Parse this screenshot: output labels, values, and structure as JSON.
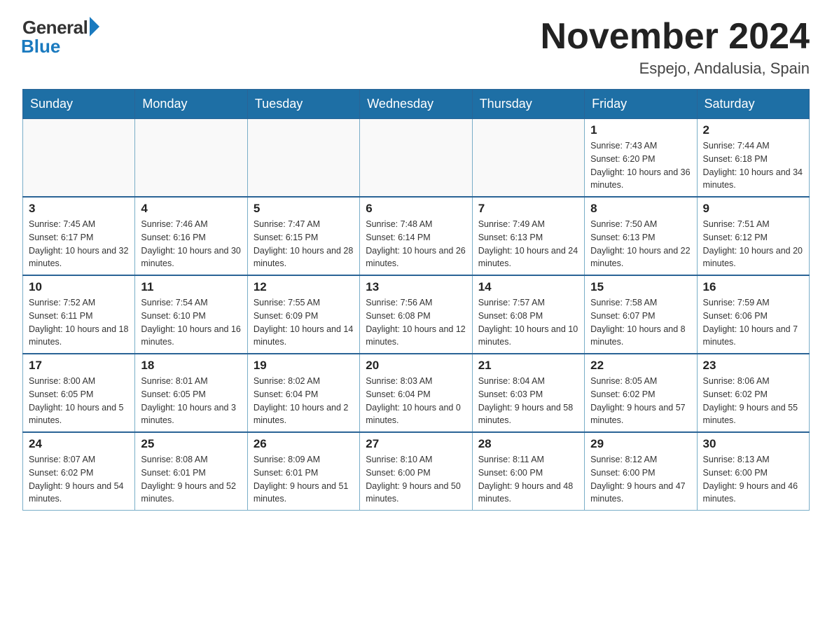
{
  "logo": {
    "general": "General",
    "blue": "Blue"
  },
  "title": "November 2024",
  "location": "Espejo, Andalusia, Spain",
  "weekdays": [
    "Sunday",
    "Monday",
    "Tuesday",
    "Wednesday",
    "Thursday",
    "Friday",
    "Saturday"
  ],
  "weeks": [
    [
      {
        "day": "",
        "info": ""
      },
      {
        "day": "",
        "info": ""
      },
      {
        "day": "",
        "info": ""
      },
      {
        "day": "",
        "info": ""
      },
      {
        "day": "",
        "info": ""
      },
      {
        "day": "1",
        "info": "Sunrise: 7:43 AM\nSunset: 6:20 PM\nDaylight: 10 hours and 36 minutes."
      },
      {
        "day": "2",
        "info": "Sunrise: 7:44 AM\nSunset: 6:18 PM\nDaylight: 10 hours and 34 minutes."
      }
    ],
    [
      {
        "day": "3",
        "info": "Sunrise: 7:45 AM\nSunset: 6:17 PM\nDaylight: 10 hours and 32 minutes."
      },
      {
        "day": "4",
        "info": "Sunrise: 7:46 AM\nSunset: 6:16 PM\nDaylight: 10 hours and 30 minutes."
      },
      {
        "day": "5",
        "info": "Sunrise: 7:47 AM\nSunset: 6:15 PM\nDaylight: 10 hours and 28 minutes."
      },
      {
        "day": "6",
        "info": "Sunrise: 7:48 AM\nSunset: 6:14 PM\nDaylight: 10 hours and 26 minutes."
      },
      {
        "day": "7",
        "info": "Sunrise: 7:49 AM\nSunset: 6:13 PM\nDaylight: 10 hours and 24 minutes."
      },
      {
        "day": "8",
        "info": "Sunrise: 7:50 AM\nSunset: 6:13 PM\nDaylight: 10 hours and 22 minutes."
      },
      {
        "day": "9",
        "info": "Sunrise: 7:51 AM\nSunset: 6:12 PM\nDaylight: 10 hours and 20 minutes."
      }
    ],
    [
      {
        "day": "10",
        "info": "Sunrise: 7:52 AM\nSunset: 6:11 PM\nDaylight: 10 hours and 18 minutes."
      },
      {
        "day": "11",
        "info": "Sunrise: 7:54 AM\nSunset: 6:10 PM\nDaylight: 10 hours and 16 minutes."
      },
      {
        "day": "12",
        "info": "Sunrise: 7:55 AM\nSunset: 6:09 PM\nDaylight: 10 hours and 14 minutes."
      },
      {
        "day": "13",
        "info": "Sunrise: 7:56 AM\nSunset: 6:08 PM\nDaylight: 10 hours and 12 minutes."
      },
      {
        "day": "14",
        "info": "Sunrise: 7:57 AM\nSunset: 6:08 PM\nDaylight: 10 hours and 10 minutes."
      },
      {
        "day": "15",
        "info": "Sunrise: 7:58 AM\nSunset: 6:07 PM\nDaylight: 10 hours and 8 minutes."
      },
      {
        "day": "16",
        "info": "Sunrise: 7:59 AM\nSunset: 6:06 PM\nDaylight: 10 hours and 7 minutes."
      }
    ],
    [
      {
        "day": "17",
        "info": "Sunrise: 8:00 AM\nSunset: 6:05 PM\nDaylight: 10 hours and 5 minutes."
      },
      {
        "day": "18",
        "info": "Sunrise: 8:01 AM\nSunset: 6:05 PM\nDaylight: 10 hours and 3 minutes."
      },
      {
        "day": "19",
        "info": "Sunrise: 8:02 AM\nSunset: 6:04 PM\nDaylight: 10 hours and 2 minutes."
      },
      {
        "day": "20",
        "info": "Sunrise: 8:03 AM\nSunset: 6:04 PM\nDaylight: 10 hours and 0 minutes."
      },
      {
        "day": "21",
        "info": "Sunrise: 8:04 AM\nSunset: 6:03 PM\nDaylight: 9 hours and 58 minutes."
      },
      {
        "day": "22",
        "info": "Sunrise: 8:05 AM\nSunset: 6:02 PM\nDaylight: 9 hours and 57 minutes."
      },
      {
        "day": "23",
        "info": "Sunrise: 8:06 AM\nSunset: 6:02 PM\nDaylight: 9 hours and 55 minutes."
      }
    ],
    [
      {
        "day": "24",
        "info": "Sunrise: 8:07 AM\nSunset: 6:02 PM\nDaylight: 9 hours and 54 minutes."
      },
      {
        "day": "25",
        "info": "Sunrise: 8:08 AM\nSunset: 6:01 PM\nDaylight: 9 hours and 52 minutes."
      },
      {
        "day": "26",
        "info": "Sunrise: 8:09 AM\nSunset: 6:01 PM\nDaylight: 9 hours and 51 minutes."
      },
      {
        "day": "27",
        "info": "Sunrise: 8:10 AM\nSunset: 6:00 PM\nDaylight: 9 hours and 50 minutes."
      },
      {
        "day": "28",
        "info": "Sunrise: 8:11 AM\nSunset: 6:00 PM\nDaylight: 9 hours and 48 minutes."
      },
      {
        "day": "29",
        "info": "Sunrise: 8:12 AM\nSunset: 6:00 PM\nDaylight: 9 hours and 47 minutes."
      },
      {
        "day": "30",
        "info": "Sunrise: 8:13 AM\nSunset: 6:00 PM\nDaylight: 9 hours and 46 minutes."
      }
    ]
  ]
}
